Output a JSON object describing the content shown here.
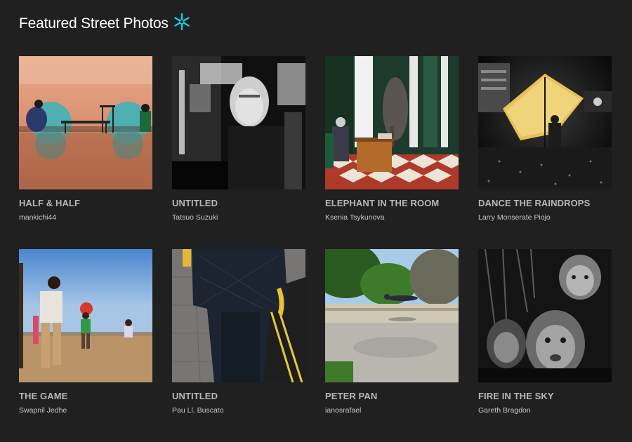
{
  "header": {
    "title": "Featured Street Photos",
    "icon": "flare-icon",
    "accent_color": "#1fc8e8"
  },
  "photos": [
    {
      "title": "HALF & HALF",
      "author": "mankichi44"
    },
    {
      "title": "UNTITLED",
      "author": "Tatsuo Suzuki"
    },
    {
      "title": "ELEPHANT IN THE ROOM",
      "author": "Ksenia Tsykunova"
    },
    {
      "title": "DANCE THE RAINDROPS",
      "author": "Larry Monserate Piojo"
    },
    {
      "title": "THE GAME",
      "author": "Swapnil Jedhe"
    },
    {
      "title": "UNTITLED",
      "author": "Pau Ll. Buscato"
    },
    {
      "title": "PETER PAN",
      "author": "ianosrafael"
    },
    {
      "title": "FIRE IN THE SKY",
      "author": "Gareth Bragdon"
    }
  ]
}
